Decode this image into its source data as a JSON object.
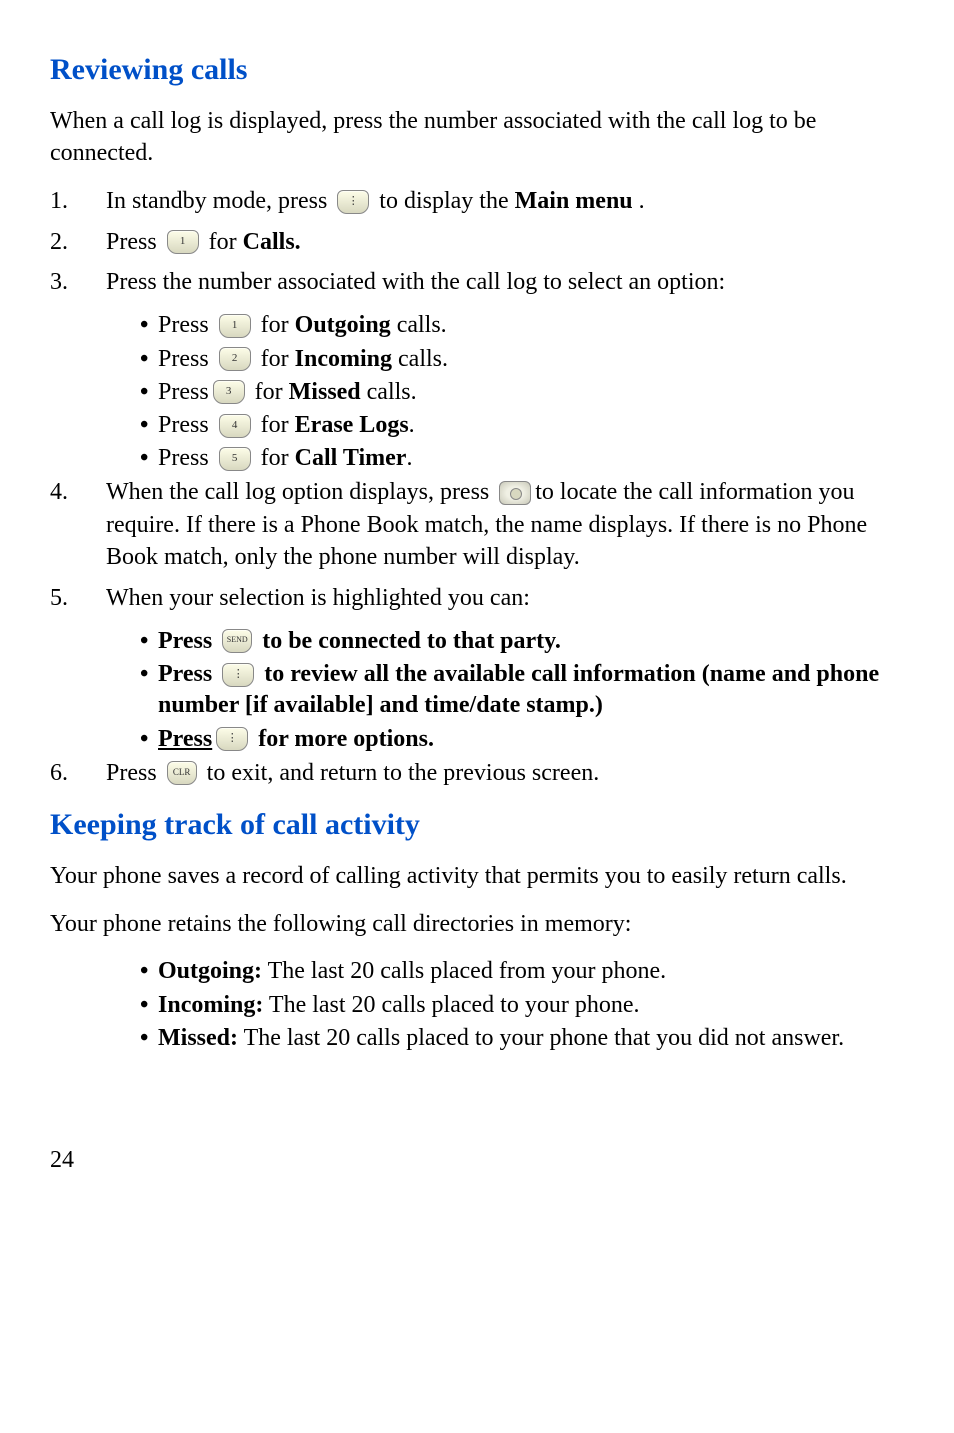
{
  "section1": {
    "heading": "Reviewing calls",
    "intro": "When a call log is displayed, press the number associated with the call log  to be connected.",
    "step1_a": "In standby mode, press ",
    "step1_b": " to display the ",
    "step1_c": "Main menu",
    "step1_d": ".",
    "step2_a": "Press ",
    "step2_b": " for ",
    "step2_c": "Calls.",
    "step3": "Press the number associated with the call log to select an option:",
    "opts": {
      "o1_a": "Press ",
      "o1_b": " for ",
      "o1_c": "Outgoing",
      "o1_d": " calls.",
      "o2_a": "Press ",
      "o2_b": " for ",
      "o2_c": "Incoming",
      "o2_d": " calls.",
      "o3_a": "Press",
      "o3_b": "  for ",
      "o3_c": "Missed",
      "o3_d": " calls.",
      "o4_a": "Press ",
      "o4_b": " for ",
      "o4_c": "Erase Logs",
      "o4_d": ".",
      "o5_a": "Press ",
      "o5_b": " for ",
      "o5_c": "Call Timer",
      "o5_d": "."
    },
    "step4_a": "When the call log option displays, press ",
    "step4_b": "to locate the call information you require. If there is a Phone Book match, the name displays. If there is no Phone Book match, only the phone number will display.",
    "step5": "When your selection is highlighted you can:",
    "sub5": {
      "a1": "Press ",
      "a2": " to be connected to that party.",
      "b1": "Press  ",
      "b2": " to review all the available call information (name and phone number [if available] and time/date stamp.)",
      "c1": "Press",
      "c2": "  for more options."
    },
    "step6_a": "Press ",
    "step6_b": " to exit, and return to the previous screen."
  },
  "section2": {
    "heading": "Keeping track of call activity",
    "p1": "Your phone saves a record of calling activity that permits you to easily return calls.",
    "p2": "Your phone retains the following call directories in memory:",
    "dirs": {
      "d1_a": "Outgoing:",
      "d1_b": " The last 20 calls placed from your phone.",
      "d2_a": "Incoming:",
      "d2_b": " The last 20 calls placed to your phone.",
      "d3_a": "Missed:",
      "d3_b": " The last 20 calls placed to your phone that you did not answer."
    }
  },
  "keys": {
    "menu": "⋮",
    "one": "1",
    "two": "2",
    "three": "3",
    "four": "4",
    "five": "5",
    "send": "SEND",
    "clr": "CLR"
  },
  "pageNumber": "24"
}
